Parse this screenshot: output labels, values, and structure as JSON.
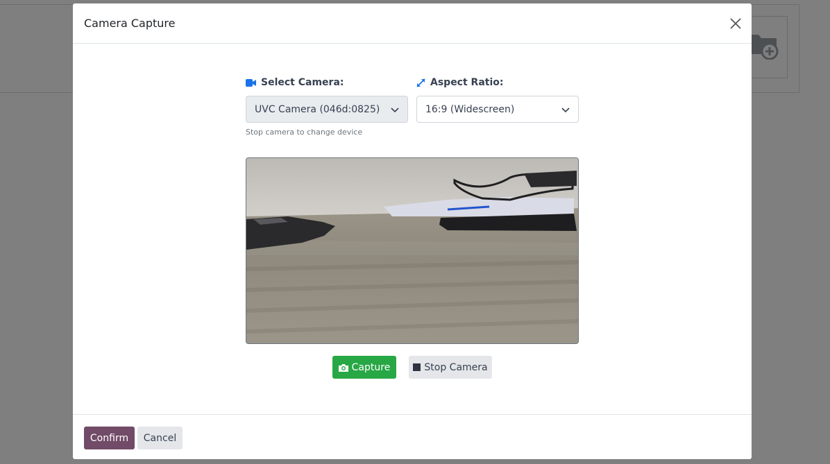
{
  "modal": {
    "title": "Camera Capture",
    "close_icon": "close-icon"
  },
  "camera_select": {
    "label": "Select Camera:",
    "icon": "video-camera-icon",
    "value": "UVC Camera (046d:0825)",
    "help_text": "Stop camera to change device",
    "disabled": true
  },
  "aspect_select": {
    "label": "Aspect Ratio:",
    "icon": "expand-arrows-icon",
    "value": "16:9 (Widescreen)"
  },
  "actions": {
    "capture_label": "Capture",
    "capture_icon": "camera-icon",
    "stop_label": "Stop Camera",
    "stop_icon": "stop-square-icon"
  },
  "footer": {
    "confirm_label": "Confirm",
    "cancel_label": "Cancel"
  },
  "colors": {
    "capture": "#28a745",
    "confirm": "#714b67",
    "label_icon": "#1a73e8"
  }
}
